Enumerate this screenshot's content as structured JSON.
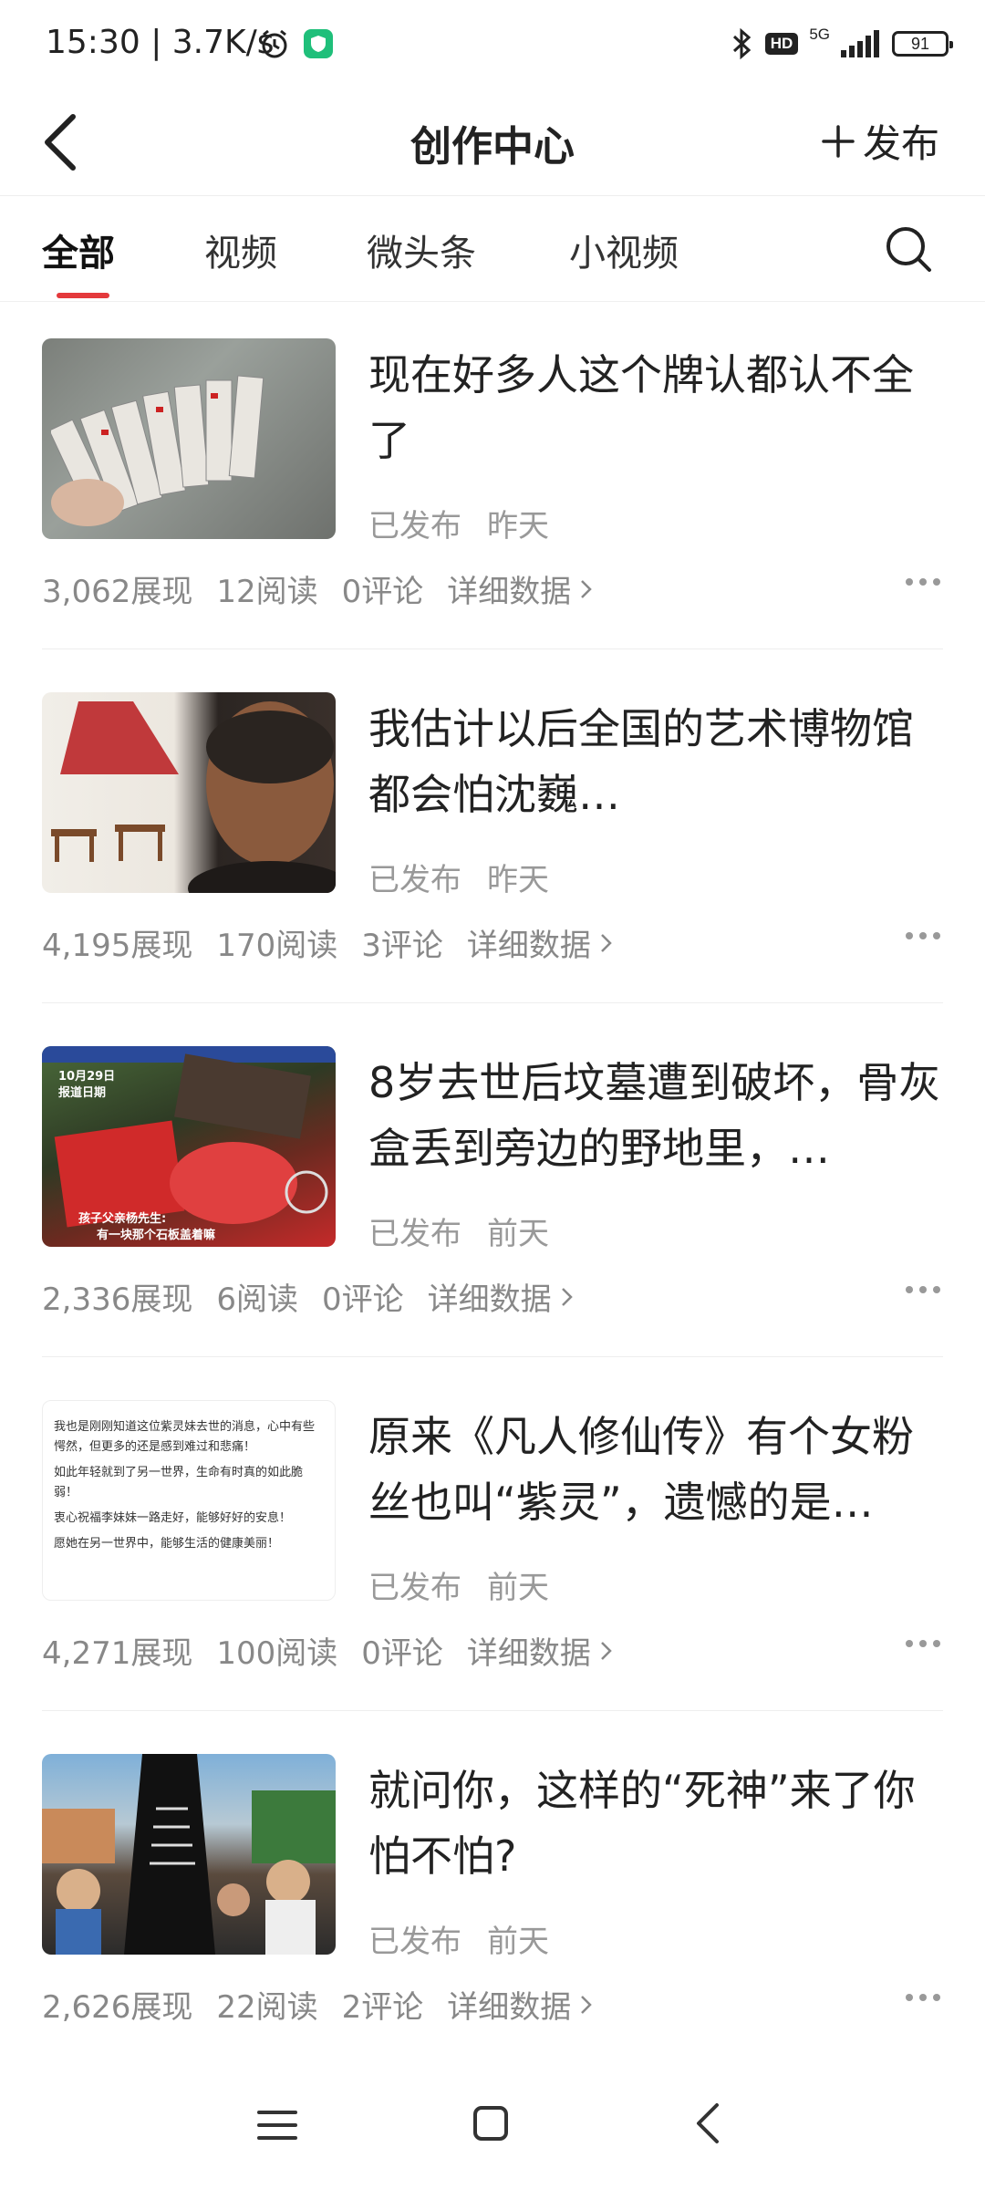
{
  "status_bar": {
    "time": "15:30",
    "network_speed": "3.7K/s",
    "hd_badge": "HD",
    "network_type": "5G",
    "battery": "91"
  },
  "header": {
    "title": "创作中心",
    "publish_label": "发布"
  },
  "tabs": [
    {
      "label": "全部",
      "active": true
    },
    {
      "label": "视频",
      "active": false
    },
    {
      "label": "微头条",
      "active": false
    },
    {
      "label": "小视频",
      "active": false
    }
  ],
  "accent_color": "#e4393c",
  "posts": [
    {
      "title": "现在好多人这个牌认都认不全了",
      "status": "已发布",
      "time": "昨天",
      "impressions": "3,062展现",
      "reads": "12阅读",
      "comments": "0评论",
      "detail_label": "详细数据"
    },
    {
      "title": "我估计以后全国的艺术博物馆都会怕沈巍…",
      "status": "已发布",
      "time": "昨天",
      "impressions": "4,195展现",
      "reads": "170阅读",
      "comments": "3评论",
      "detail_label": "详细数据"
    },
    {
      "title": "8岁去世后坟墓遭到破坏，骨灰盒丢到旁边的野地里，…",
      "status": "已发布",
      "time": "前天",
      "impressions": "2,336展现",
      "reads": "6阅读",
      "comments": "0评论",
      "detail_label": "详细数据",
      "thumb_text": [
        "10月29日",
        "报道日期",
        "孩子父亲杨先生:",
        "有一块那个石板盖着嘛"
      ]
    },
    {
      "title": "原来《凡人修仙传》有个女粉丝也叫“紫灵”，遗憾的是…",
      "status": "已发布",
      "time": "前天",
      "impressions": "4,271展现",
      "reads": "100阅读",
      "comments": "0评论",
      "detail_label": "详细数据",
      "thumb_text": [
        "我也是刚刚知道这位紫灵妹去世的消息，心中有些愕然，但更多的还是感到难过和悲痛！",
        "如此年轻就到了另一世界，生命有时真的如此脆弱！",
        "衷心祝福李妹妹一路走好，能够好好的安息！",
        "愿她在另一世界中，能够生活的健康美丽！"
      ]
    },
    {
      "title": "就问你，这样的“死神”来了你怕不怕?",
      "status": "已发布",
      "time": "前天",
      "impressions": "2,626展现",
      "reads": "22阅读",
      "comments": "2评论",
      "detail_label": "详细数据"
    }
  ]
}
